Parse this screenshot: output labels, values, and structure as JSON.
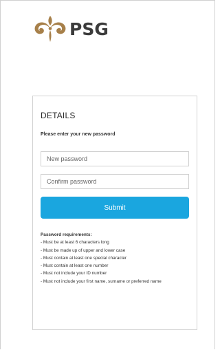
{
  "brand": {
    "name": "PSG",
    "logo_color": "#a7804a"
  },
  "form": {
    "title": "DETAILS",
    "instruction": "Please enter your new password",
    "new_password_placeholder": "New password",
    "confirm_password_placeholder": "Confirm password",
    "submit_label": "Submit",
    "submit_color": "#1aa6df"
  },
  "requirements": {
    "title": "Password requirements:",
    "items": [
      "-   Must be at least 6 characters long",
      "-   Must be made up of upper and lower case",
      "-   Must contain at least one special character",
      "-   Must contain at least one number",
      "-   Must not include your ID number",
      "-   Must not include your first name, surname or preferred name"
    ]
  }
}
